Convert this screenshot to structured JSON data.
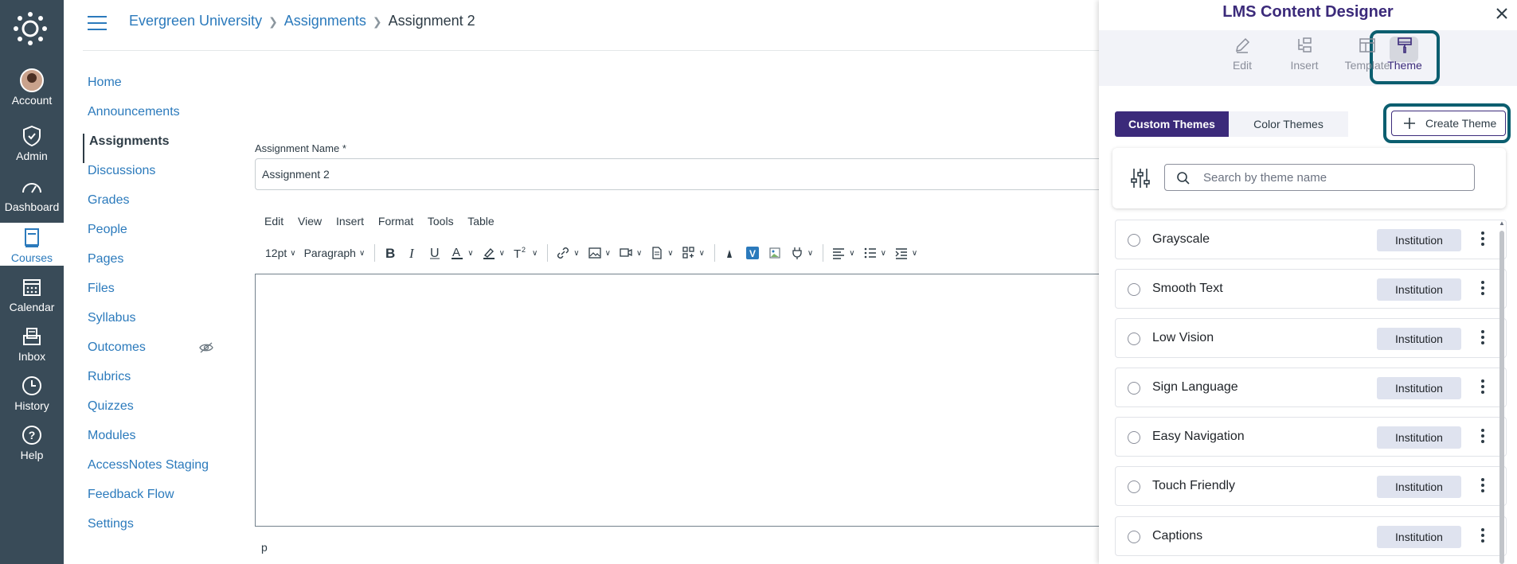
{
  "global_nav": {
    "account": "Account",
    "admin": "Admin",
    "dashboard": "Dashboard",
    "courses": "Courses",
    "calendar": "Calendar",
    "inbox": "Inbox",
    "history": "History",
    "help": "Help"
  },
  "breadcrumb": {
    "root": "Evergreen University",
    "section": "Assignments",
    "current": "Assignment 2"
  },
  "course_nav": [
    {
      "label": "Home"
    },
    {
      "label": "Announcements"
    },
    {
      "label": "Assignments"
    },
    {
      "label": "Discussions"
    },
    {
      "label": "Grades"
    },
    {
      "label": "People"
    },
    {
      "label": "Pages"
    },
    {
      "label": "Files"
    },
    {
      "label": "Syllabus"
    },
    {
      "label": "Outcomes"
    },
    {
      "label": "Rubrics"
    },
    {
      "label": "Quizzes"
    },
    {
      "label": "Modules"
    },
    {
      "label": "AccessNotes Staging"
    },
    {
      "label": "Feedback Flow"
    },
    {
      "label": "Settings"
    }
  ],
  "form": {
    "name_label": "Assignment Name *",
    "name_value": "Assignment 2"
  },
  "editor": {
    "menu": [
      "Edit",
      "View",
      "Insert",
      "Format",
      "Tools",
      "Table"
    ],
    "font_size": "12pt",
    "block_format": "Paragraph",
    "status_path": "p"
  },
  "panel": {
    "title": "LMS Content Designer",
    "tabs": {
      "edit": "Edit",
      "insert": "Insert",
      "template": "Template",
      "theme": "Theme"
    },
    "segment": {
      "custom": "Custom Themes",
      "color": "Color Themes"
    },
    "create_label": "Create Theme",
    "search_placeholder": "Search by theme name",
    "themes": [
      {
        "name": "Grayscale",
        "badge": "Institution"
      },
      {
        "name": "Smooth Text",
        "badge": "Institution"
      },
      {
        "name": "Low Vision",
        "badge": "Institution"
      },
      {
        "name": "Sign Language",
        "badge": "Institution"
      },
      {
        "name": "Easy Navigation",
        "badge": "Institution"
      },
      {
        "name": "Touch Friendly",
        "badge": "Institution"
      },
      {
        "name": "Captions",
        "badge": "Institution"
      }
    ]
  },
  "colors": {
    "nav_bg": "#394b58",
    "link": "#2b7abc",
    "brand_purple": "#3b2a7a",
    "highlight_teal": "#0b5e6f"
  }
}
